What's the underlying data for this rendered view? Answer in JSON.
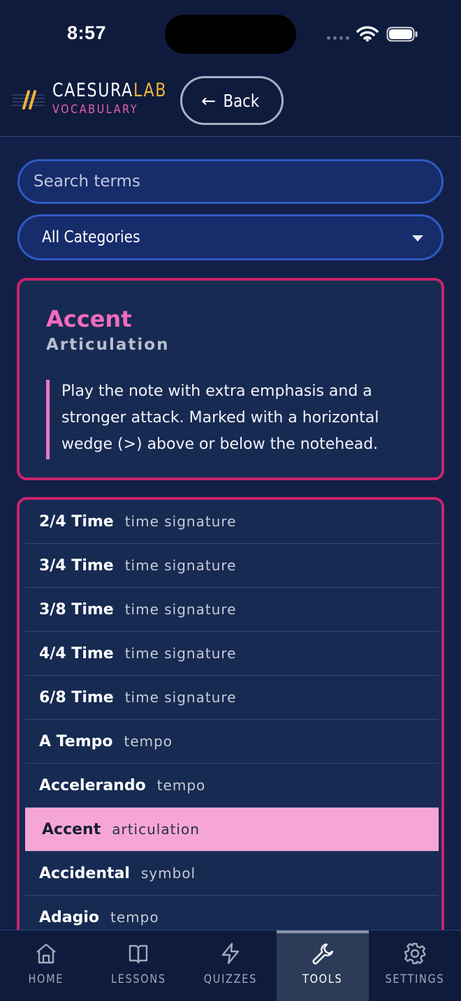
{
  "status": {
    "time": "8:57"
  },
  "header": {
    "brand_part1": "CAESURA",
    "brand_part2": "LAB",
    "subtitle": "VOCABULARY",
    "back_label": "Back",
    "back_arrow": "←"
  },
  "search": {
    "placeholder": "Search terms",
    "value": ""
  },
  "filter": {
    "selected": "All Categories"
  },
  "detail": {
    "term": "Accent",
    "category": "Articulation",
    "definition": "Play the note with extra emphasis and a stronger attack. Marked with a horizontal wedge (>) above or below the notehead."
  },
  "list": {
    "items": [
      {
        "term": "2/4 Time",
        "category": "time signature"
      },
      {
        "term": "3/4 Time",
        "category": "time signature"
      },
      {
        "term": "3/8 Time",
        "category": "time signature"
      },
      {
        "term": "4/4 Time",
        "category": "time signature"
      },
      {
        "term": "6/8 Time",
        "category": "time signature"
      },
      {
        "term": "A Tempo",
        "category": "tempo"
      },
      {
        "term": "Accelerando",
        "category": "tempo"
      },
      {
        "term": "Accent",
        "category": "articulation",
        "selected": true
      },
      {
        "term": "Accidental",
        "category": "symbol"
      },
      {
        "term": "Adagio",
        "category": "tempo"
      }
    ]
  },
  "tabs": [
    {
      "label": "HOME",
      "icon": "home-icon"
    },
    {
      "label": "LESSONS",
      "icon": "book-icon"
    },
    {
      "label": "QUIZZES",
      "icon": "lightning-icon"
    },
    {
      "label": "TOOLS",
      "icon": "wrench-icon",
      "active": true
    },
    {
      "label": "SETTINGS",
      "icon": "gear-icon"
    }
  ],
  "colors": {
    "background": "#122048",
    "accent_pink": "#c9236a",
    "term_pink": "#f06bbd",
    "selected_row": "#f6a6d5",
    "brand_yellow": "#f2b535"
  }
}
